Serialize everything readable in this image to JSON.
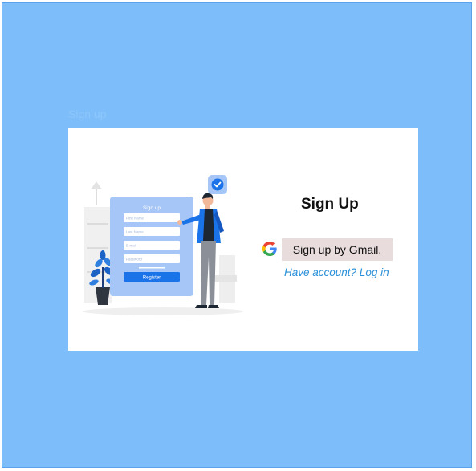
{
  "background_title": "Sign up",
  "signup_title": "Sign Up",
  "google_button_label": "Sign up by Gmail.",
  "login_link": "Have account? Log in",
  "illustration_form": {
    "title": "Sign up",
    "fields": [
      "First Name",
      "Last Name",
      "E-mail",
      "Password"
    ],
    "register_label": "Register"
  },
  "icons": {
    "google": "google-icon",
    "check": "check-icon",
    "plant": "plant-icon"
  },
  "colors": {
    "background": "#7dbdf9",
    "card": "#ffffff",
    "button": "#e8dcdc",
    "link": "#2a8fd8"
  }
}
